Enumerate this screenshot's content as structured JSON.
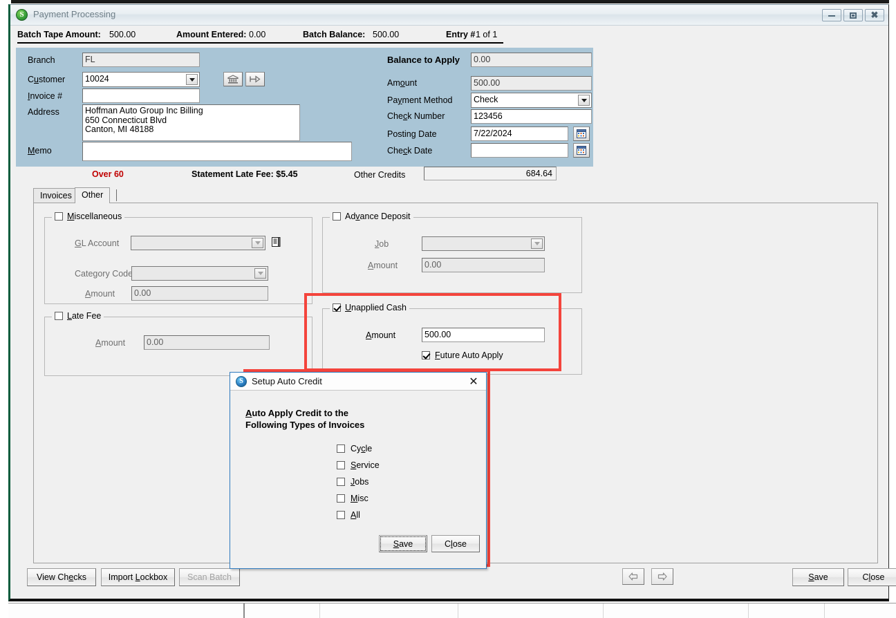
{
  "window": {
    "title": "Payment Processing",
    "icon": "app-s-icon",
    "minimize_label": "minimize-icon",
    "maximize_label": "maximize-icon",
    "close_label": "close-icon"
  },
  "batch": {
    "tape_amount_label": "Batch Tape Amount:",
    "tape_amount_value": "500.00",
    "amount_entered_label": "Amount Entered:",
    "amount_entered_value": "0.00",
    "batch_balance_label": "Batch Balance:",
    "batch_balance_value": "500.00",
    "entry_label": "Entry #",
    "entry_value": "1 of 1"
  },
  "form_left": {
    "branch_label": "Branch",
    "branch_value": "FL",
    "customer_label": "Customer",
    "customer_value": "10024",
    "invoice_label": "Invoice #",
    "invoice_value": "",
    "address_label": "Address",
    "address_value": "Hoffman Auto Group Inc Billing\n650 Connecticut Blvd\nCanton, MI  48188",
    "memo_label": "Memo",
    "memo_value": ""
  },
  "form_right": {
    "balance_to_apply_label": "Balance to Apply",
    "balance_to_apply_value": "0.00",
    "amount_label": "Amount",
    "amount_value": "500.00",
    "payment_method_label": "Payment Method",
    "payment_method_value": "Check",
    "check_number_label": "Check Number",
    "check_number_value": "123456",
    "posting_date_label": "Posting Date",
    "posting_date_value": "7/22/2024",
    "check_date_label": "Check Date",
    "check_date_value": ""
  },
  "status_row": {
    "over_60": "Over 60",
    "over_60_color": "#c00000",
    "statement_late_fee": "Statement Late Fee: $5.45",
    "other_credits_label": "Other Credits",
    "other_credits_value": "684.64"
  },
  "tabs": [
    {
      "label": "Invoices",
      "active": false
    },
    {
      "label": "Other",
      "active": true
    }
  ],
  "miscellaneous": {
    "title": "Miscellaneous",
    "checked": false,
    "gl_account_label": "GL Account",
    "gl_account_value": "",
    "category_code_label": "Category Code",
    "category_code_value": "",
    "amount_label": "Amount",
    "amount_value": "0.00",
    "lookup_icon": "ledger-lookup-icon"
  },
  "late_fee": {
    "title": "Late Fee",
    "checked": false,
    "amount_label": "Amount",
    "amount_value": "0.00"
  },
  "advance_deposit": {
    "title": "Advance Deposit",
    "checked": false,
    "job_label": "Job",
    "job_value": "",
    "amount_label": "Amount",
    "amount_value": "0.00"
  },
  "unapplied_cash": {
    "title": "Unapplied Cash",
    "checked": true,
    "amount_label": "Amount",
    "amount_value": "500.00",
    "future_auto_apply_label": "Future Auto Apply",
    "future_auto_apply_checked": true
  },
  "dialog": {
    "title": "Setup Auto Credit",
    "icon": "app-s-icon",
    "close_icon": "close-icon",
    "heading": "Auto Apply Credit to the\nFollowing Types of Invoices",
    "options": [
      {
        "label": "Cycle",
        "checked": false
      },
      {
        "label": "Service",
        "checked": false
      },
      {
        "label": "Jobs",
        "checked": false
      },
      {
        "label": "Misc",
        "checked": false
      },
      {
        "label": "All",
        "checked": false
      }
    ],
    "save_label": "Save",
    "close_label": "Close"
  },
  "footer": {
    "view_checks": "View Checks",
    "import_lockbox": "Import Lockbox",
    "scan_batch": "Scan Batch",
    "scan_batch_disabled": true,
    "prev_icon": "arrow-left-icon",
    "next_icon": "arrow-right-icon",
    "save_label": "Save",
    "close_label": "Close"
  },
  "highlights": {
    "color": "#f4443c"
  }
}
